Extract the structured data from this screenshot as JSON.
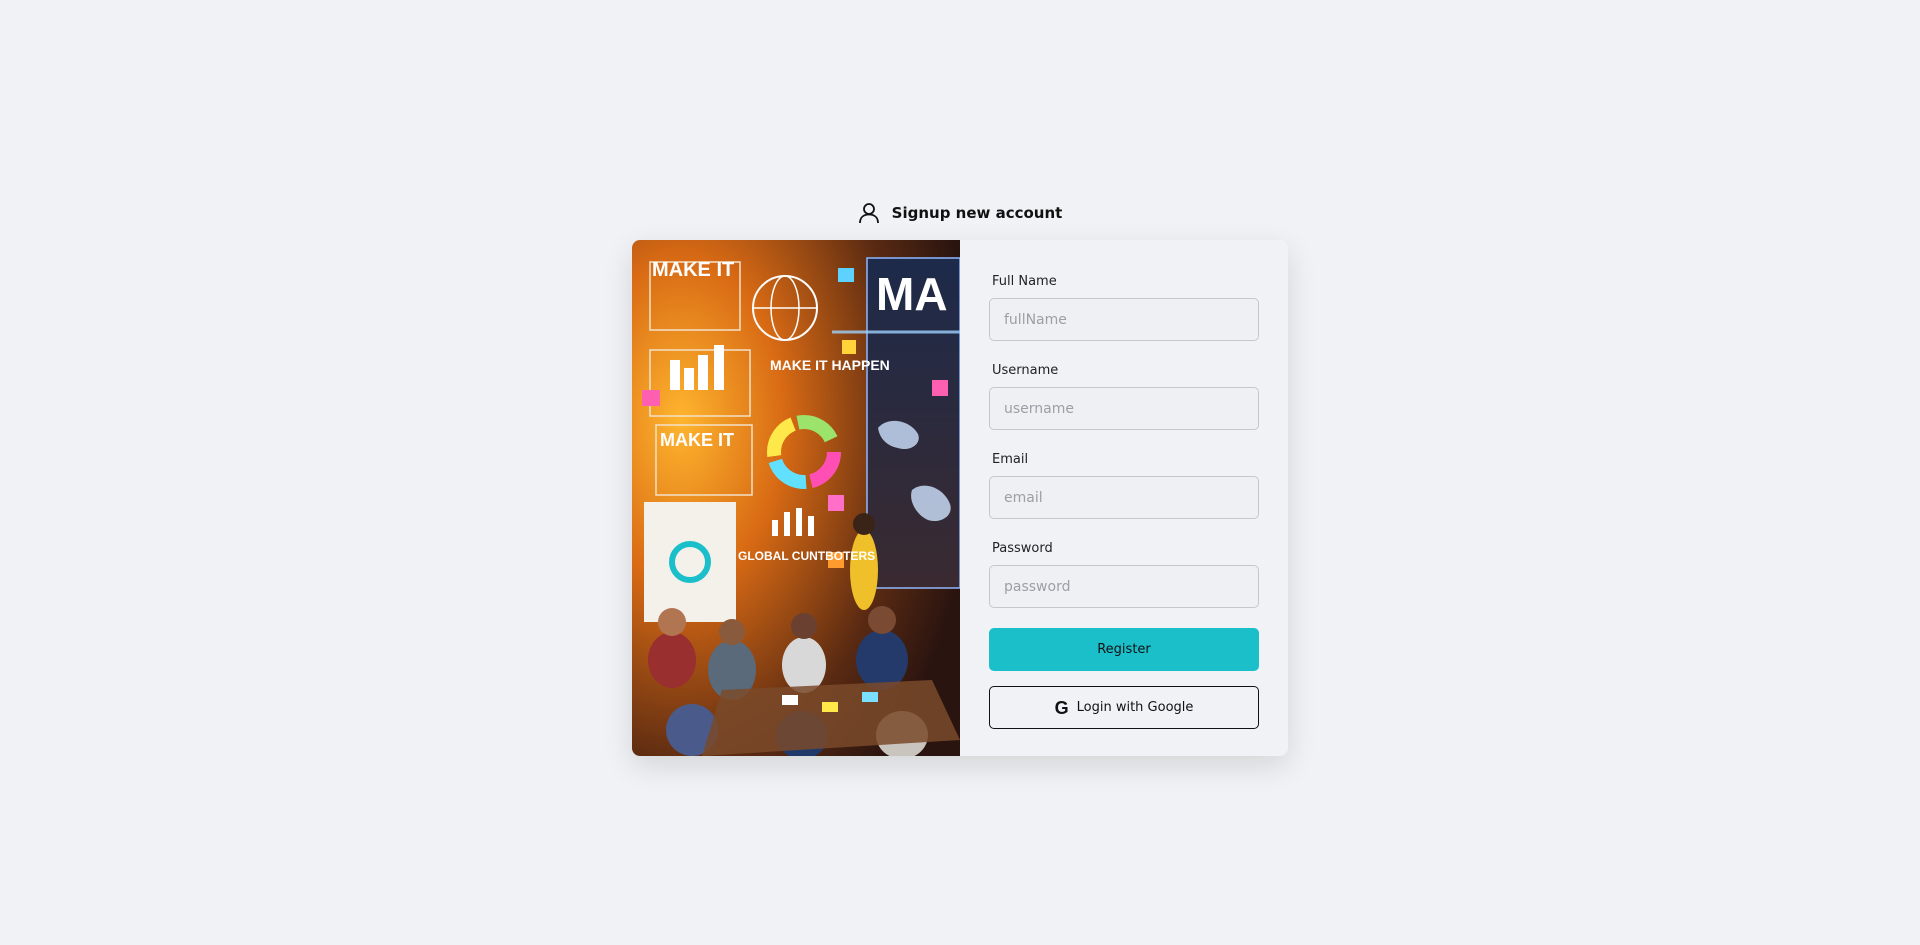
{
  "header": {
    "title": "Signup new account",
    "icon": "user-icon"
  },
  "hero": {
    "texts": [
      "MAKE IT",
      "MAKE IT HAPPEN",
      "MAKE IT",
      "GLOBAL CUNTBOTERS",
      "MA"
    ]
  },
  "form": {
    "fields": [
      {
        "label": "Full Name",
        "placeholder": "fullName"
      },
      {
        "label": "Username",
        "placeholder": "username"
      },
      {
        "label": "Email",
        "placeholder": "email"
      },
      {
        "label": "Password",
        "placeholder": "password"
      }
    ],
    "register_label": "Register",
    "google_label": "Login with Google",
    "google_icon": "google-icon"
  },
  "colors": {
    "accent": "#1bbfca",
    "background": "#f0f2f5"
  }
}
